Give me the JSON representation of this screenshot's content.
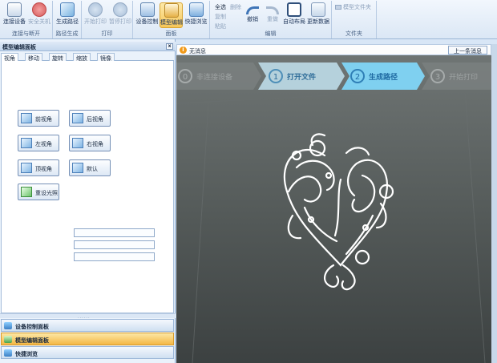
{
  "ribbon": {
    "groups": [
      {
        "caption": "连接与断开",
        "buttons": [
          {
            "label": "连接设备",
            "icon": "printer-connect-icon"
          },
          {
            "label": "安全关机",
            "icon": "power-icon"
          }
        ]
      },
      {
        "caption": "路径生成",
        "buttons": [
          {
            "label": "生成路径",
            "icon": "path-generate-icon"
          }
        ]
      },
      {
        "caption": "打印",
        "buttons": [
          {
            "label": "开始打印",
            "icon": "play-icon"
          },
          {
            "label": "暂停打印",
            "icon": "pause-icon"
          }
        ]
      },
      {
        "caption": "面板",
        "buttons": [
          {
            "label": "设备控制",
            "icon": "device-control-icon"
          },
          {
            "label": "模型编辑",
            "icon": "model-edit-icon"
          },
          {
            "label": "快捷浏览",
            "icon": "quick-browse-icon"
          }
        ]
      },
      {
        "caption": "编辑",
        "small": [
          "全选",
          "删除",
          "复制",
          "粘贴"
        ],
        "buttons": [
          {
            "label": "撤销",
            "icon": "undo-icon"
          },
          {
            "label": "重做",
            "icon": "redo-icon"
          },
          {
            "label": "自动布局",
            "icon": "auto-layout-icon"
          },
          {
            "label": "更新数据",
            "icon": "update-data-icon"
          }
        ]
      },
      {
        "caption": "文件夹",
        "small": [
          "模型文件夹"
        ]
      }
    ]
  },
  "left_panel": {
    "title": "模型编辑面板",
    "close": "x",
    "tabs": [
      "视角",
      "移动",
      "旋转",
      "缩放",
      "镜像"
    ],
    "view_buttons": [
      "前视角",
      "后视角",
      "左视角",
      "右视角",
      "顶视角",
      "默认",
      "重设光照"
    ],
    "grip": "......",
    "nav": [
      "设备控制面板",
      "模型编辑面板",
      "快捷浏览"
    ]
  },
  "message_bar": {
    "icon": "i",
    "text": "无消息",
    "prev_button": "上一条消息"
  },
  "steps": {
    "items": [
      {
        "num": "0",
        "label": "非连接设备"
      },
      {
        "num": "1",
        "label": "打开文件"
      },
      {
        "num": "2",
        "label": "生成路径"
      },
      {
        "num": "3",
        "label": "开始打印"
      }
    ]
  },
  "colors": {
    "ribbon_top": "#f2f7fd",
    "viewport": "#545a5a",
    "model": "#ffffff",
    "step_active": "#7fd0f0",
    "nav_active": "#f4b744"
  }
}
